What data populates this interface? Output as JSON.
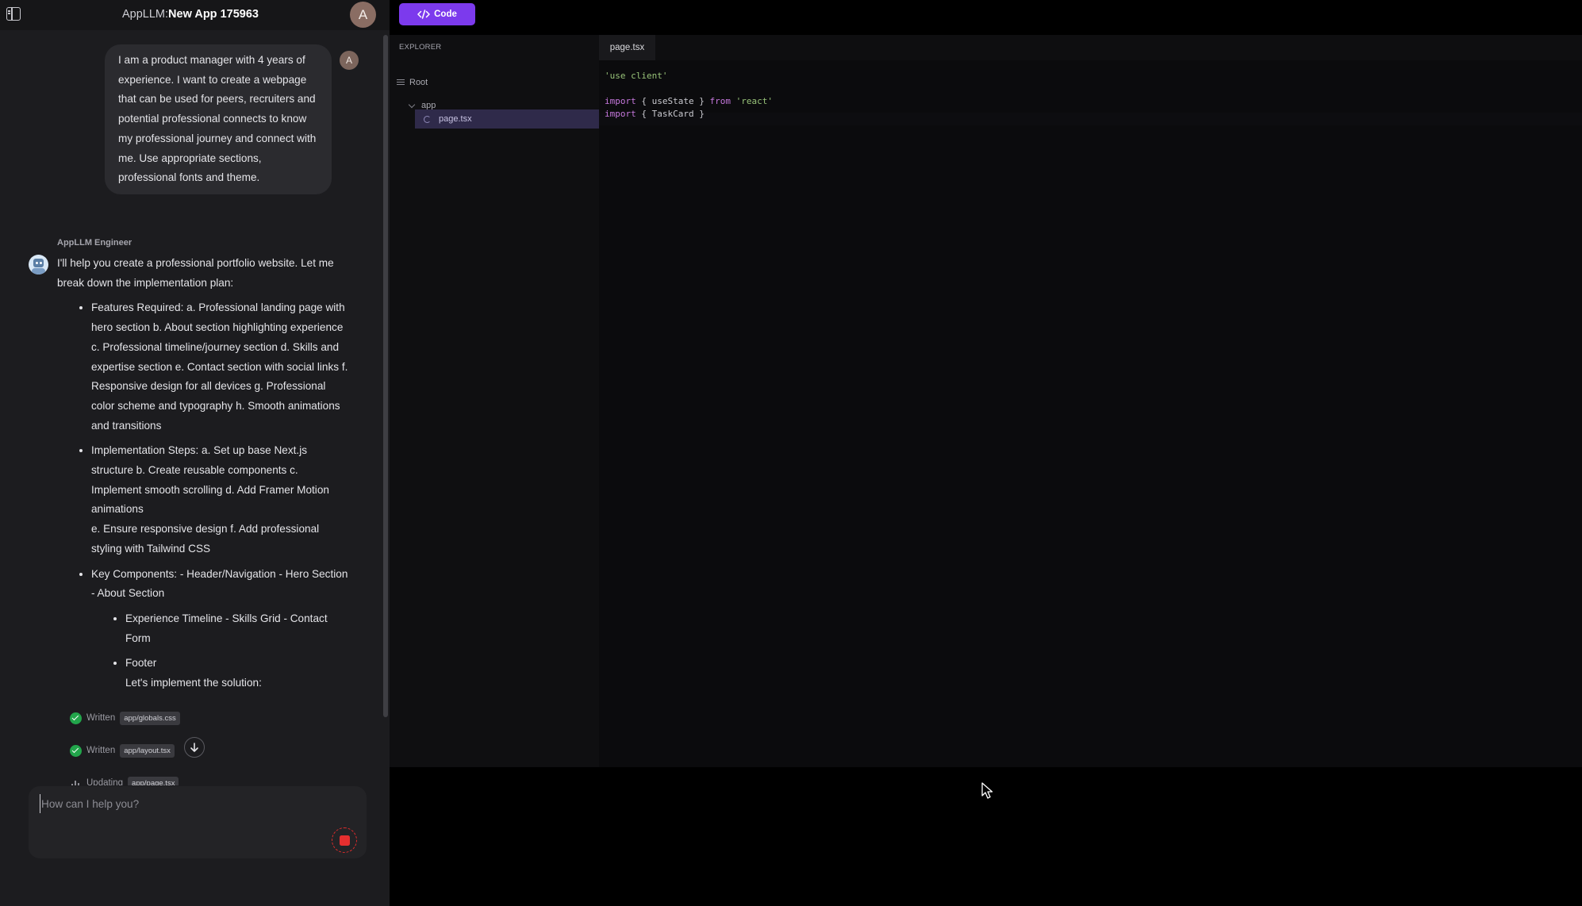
{
  "topbar": {
    "title_prefix": "AppLLM:",
    "title_name": "New App 175963",
    "avatar_letter": "A",
    "code_button_label": "Code"
  },
  "chat": {
    "user_message": "I am a product manager with 4 years of experience. I want to create a webpage that can be used for peers, recruiters and potential professional connects to know my professional journey and connect with me. Use appropriate sections, professional fonts and theme.",
    "user_avatar_letter": "A",
    "engineer_name": "AppLLM Engineer",
    "bot_intro": "I'll help you create a professional portfolio website. Let me break down the implementation plan:",
    "bullet_features": "Features Required: a. Professional landing page with hero section b. About section highlighting experience c. Professional timeline/journey section d. Skills and expertise section e. Contact section with social links f. Responsive design for all devices g. Professional color scheme and typography h. Smooth animations and transitions",
    "bullet_steps_1": "Implementation Steps: a. Set up base Next.js structure b. Create reusable components c. Implement smooth scrolling d. Add Framer Motion animations",
    "bullet_steps_2": "e. Ensure responsive design f. Add professional styling with Tailwind CSS",
    "bullet_components": "Key Components: - Header/Navigation - Hero Section - About Section",
    "sub_bullet_1": "Experience Timeline - Skills Grid - Contact Form",
    "sub_bullet_2": "Footer",
    "closing_line": "Let's implement the solution:",
    "status_items": [
      {
        "label": "Written",
        "file": "app/globals.css"
      },
      {
        "label": "Written",
        "file": "app/layout.tsx"
      },
      {
        "label": "Updating",
        "file": "app/page.tsx"
      }
    ],
    "composer_placeholder": "How can I help you?"
  },
  "explorer": {
    "title": "EXPLORER",
    "root_label": "Root",
    "folder_label": "app",
    "file_label": "page.tsx"
  },
  "editor": {
    "active_tab": "page.tsx",
    "code_lines": [
      {
        "str": "'use client'"
      },
      {},
      {
        "kw": "import",
        "mid": " { useState } ",
        "kw2": "from",
        "str": " 'react'"
      },
      {
        "kw": "import",
        "mid": " { TaskCard }"
      }
    ]
  },
  "colors": {
    "accent": "#7c3aed",
    "success": "#22a54b",
    "stop": "#e52f2f"
  }
}
